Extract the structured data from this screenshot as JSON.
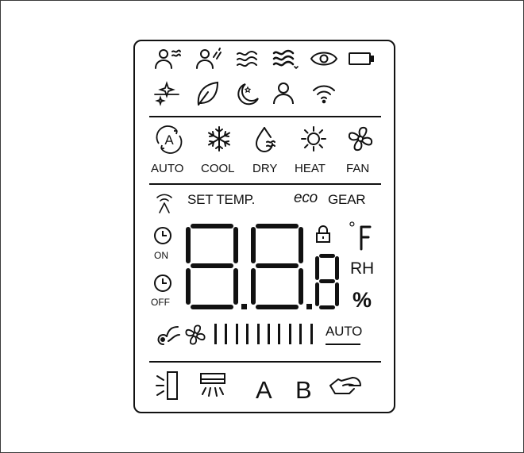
{
  "panel": {
    "modes": [
      {
        "key": "auto",
        "label": "AUTO"
      },
      {
        "key": "cool",
        "label": "COOL"
      },
      {
        "key": "dry",
        "label": "DRY"
      },
      {
        "key": "heat",
        "label": "HEAT"
      },
      {
        "key": "fan",
        "label": "FAN"
      }
    ],
    "status_row": {
      "set_temp_label": "SET TEMP.",
      "eco_label": "eco",
      "gear_label": "GEAR"
    },
    "timers": {
      "on_label": "ON",
      "off_label": "OFF"
    },
    "units": {
      "degree_symbol": "°",
      "fahrenheit": "F",
      "rh": "RH",
      "percent": "%"
    },
    "fan_speed": {
      "auto_label": "AUTO",
      "levels": 10
    },
    "bottom_row": {
      "letter_a": "A",
      "letter_b": "B"
    }
  },
  "colors": {
    "ink": "#111111",
    "background": "#ffffff"
  }
}
